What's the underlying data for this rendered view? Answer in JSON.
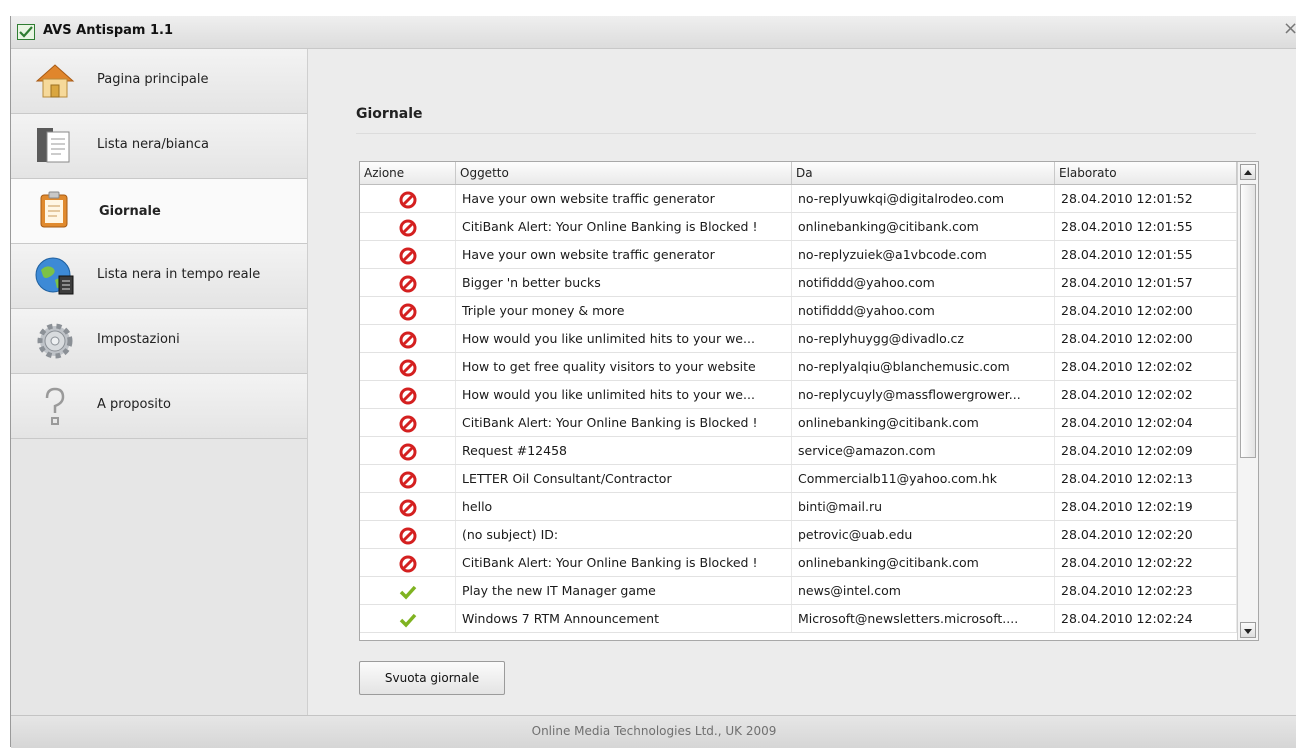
{
  "window": {
    "title": "AVS Antispam 1.1",
    "close_symbol": "×"
  },
  "sidebar": {
    "items": [
      {
        "label": "Pagina principale",
        "icon": "home-icon",
        "active": false
      },
      {
        "label": "Lista nera/bianca",
        "icon": "list-document-icon",
        "active": false
      },
      {
        "label": "Giornale",
        "icon": "clipboard-icon",
        "active": true
      },
      {
        "label": "Lista nera in tempo reale",
        "icon": "globe-icon",
        "active": false
      },
      {
        "label": "Impostazioni",
        "icon": "gear-icon",
        "active": false
      },
      {
        "label": "A proposito",
        "icon": "question-icon",
        "active": false
      }
    ]
  },
  "main": {
    "title": "Giornale",
    "columns": [
      "Azione",
      "Oggetto",
      "Da",
      "Elaborato"
    ],
    "rows": [
      {
        "action": "blocked",
        "subject": "Have your own website traffic generator",
        "from": "no-replyuwkqi@digitalrodeo.com",
        "date": "28.04.2010 12:01:52"
      },
      {
        "action": "blocked",
        "subject": "CitiBank Alert: Your Online Banking is Blocked !",
        "from": "onlinebanking@citibank.com",
        "date": "28.04.2010 12:01:55"
      },
      {
        "action": "blocked",
        "subject": "Have your own website traffic generator",
        "from": "no-replyzuiek@a1vbcode.com",
        "date": "28.04.2010 12:01:55"
      },
      {
        "action": "blocked",
        "subject": "Bigger 'n better bucks",
        "from": "notifiddd@yahoo.com",
        "date": "28.04.2010 12:01:57"
      },
      {
        "action": "blocked",
        "subject": "Triple your money & more",
        "from": "notifiddd@yahoo.com",
        "date": "28.04.2010 12:02:00"
      },
      {
        "action": "blocked",
        "subject": "How would you like unlimited hits to your we...",
        "from": "no-replyhuygg@divadlo.cz",
        "date": "28.04.2010 12:02:00"
      },
      {
        "action": "blocked",
        "subject": "How to get free quality visitors to your website",
        "from": "no-replyalqiu@blanchemusic.com",
        "date": "28.04.2010 12:02:02"
      },
      {
        "action": "blocked",
        "subject": "How would you like unlimited hits to your we...",
        "from": "no-replycuyly@massflowergrower...",
        "date": "28.04.2010 12:02:02"
      },
      {
        "action": "blocked",
        "subject": "CitiBank Alert: Your Online Banking is Blocked !",
        "from": "onlinebanking@citibank.com",
        "date": "28.04.2010 12:02:04"
      },
      {
        "action": "blocked",
        "subject": "Request #12458",
        "from": "service@amazon.com",
        "date": "28.04.2010 12:02:09"
      },
      {
        "action": "blocked",
        "subject": "LETTER Oil Consultant/Contractor",
        "from": "Commercialb11@yahoo.com.hk",
        "date": "28.04.2010 12:02:13"
      },
      {
        "action": "blocked",
        "subject": "hello",
        "from": "binti@mail.ru",
        "date": "28.04.2010 12:02:19"
      },
      {
        "action": "blocked",
        "subject": "(no subject) ID:",
        "from": "petrovic@uab.edu",
        "date": "28.04.2010 12:02:20"
      },
      {
        "action": "blocked",
        "subject": "CitiBank Alert: Your Online Banking is Blocked !",
        "from": "onlinebanking@citibank.com",
        "date": "28.04.2010 12:02:22"
      },
      {
        "action": "allowed",
        "subject": "Play the new IT Manager game",
        "from": "news@intel.com",
        "date": "28.04.2010 12:02:23"
      },
      {
        "action": "allowed",
        "subject": "Windows 7 RTM Announcement",
        "from": "Microsoft@newsletters.microsoft....",
        "date": "28.04.2010 12:02:24"
      }
    ],
    "clear_button": "Svuota giornale"
  },
  "footer": {
    "text": "Online Media Technologies Ltd., UK 2009"
  },
  "colors": {
    "blocked_icon": "#d42020",
    "allowed_icon": "#7fb321"
  }
}
